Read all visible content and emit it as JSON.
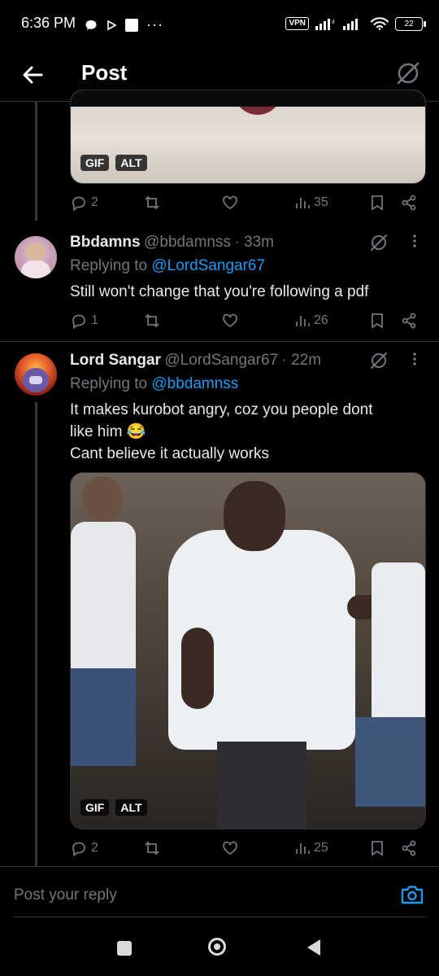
{
  "status_bar": {
    "time": "6:36 PM",
    "vpn": "VPN",
    "battery": "22",
    "icons": [
      "chat-bubble-icon",
      "play-store-icon",
      "square-notification-icon",
      "more-dots-icon",
      "signal-icon",
      "wifi-icon"
    ]
  },
  "header": {
    "title": "Post",
    "icons": [
      "back-arrow-icon",
      "grok-icon"
    ]
  },
  "tweets": [
    {
      "media": {
        "badges": [
          "GIF",
          "ALT"
        ]
      },
      "replies": "2",
      "reposts": "",
      "likes": "",
      "views": "35"
    },
    {
      "name": "Bbdamns",
      "handle": "@bbdamnss",
      "time": "· 33m",
      "replying_prefix": "Replying to ",
      "replying_to": "@LordSangar67",
      "text": "Still won't change that you're following a pdf",
      "replies": "1",
      "views": "26"
    },
    {
      "name": "Lord Sangar",
      "handle": "@LordSangar67",
      "time": "· 22m",
      "replying_prefix": "Replying to ",
      "replying_to": "@bbdamnss",
      "text_line1": "It makes kurobot angry, coz you people dont",
      "text_line2": "like him 😂",
      "text_line3": "Cant believe it actually works",
      "media": {
        "badges": [
          "GIF",
          "ALT"
        ]
      },
      "replies": "2",
      "views": "25"
    }
  ],
  "reply_bar": {
    "placeholder": "Post your reply"
  },
  "colors": {
    "background": "#000000",
    "accent": "#1d9bf0",
    "muted": "#71767b",
    "text": "#e7e9ea"
  }
}
